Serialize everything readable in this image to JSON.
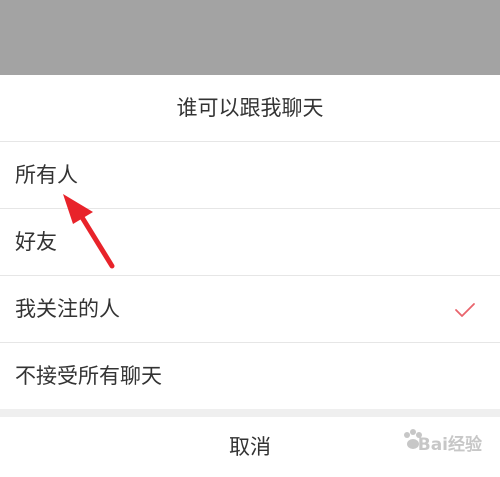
{
  "dialog": {
    "title": "谁可以跟我聊天",
    "options": [
      {
        "label": "所有人",
        "selected": false
      },
      {
        "label": "好友",
        "selected": false
      },
      {
        "label": "我关注的人",
        "selected": true
      },
      {
        "label": "不接受所有聊天",
        "selected": false
      }
    ],
    "cancel_label": "取消"
  },
  "watermark": {
    "text": "Bai经验"
  },
  "colors": {
    "backdrop": "#a3a3a3",
    "check": "#e9646c",
    "arrow": "#e8232a",
    "text": "#333333",
    "divider": "#e6e6e6"
  },
  "icons": {
    "selected_indicator": "checkmark-icon",
    "annotation": "red-arrow-icon",
    "watermark_logo": "paw-icon"
  }
}
